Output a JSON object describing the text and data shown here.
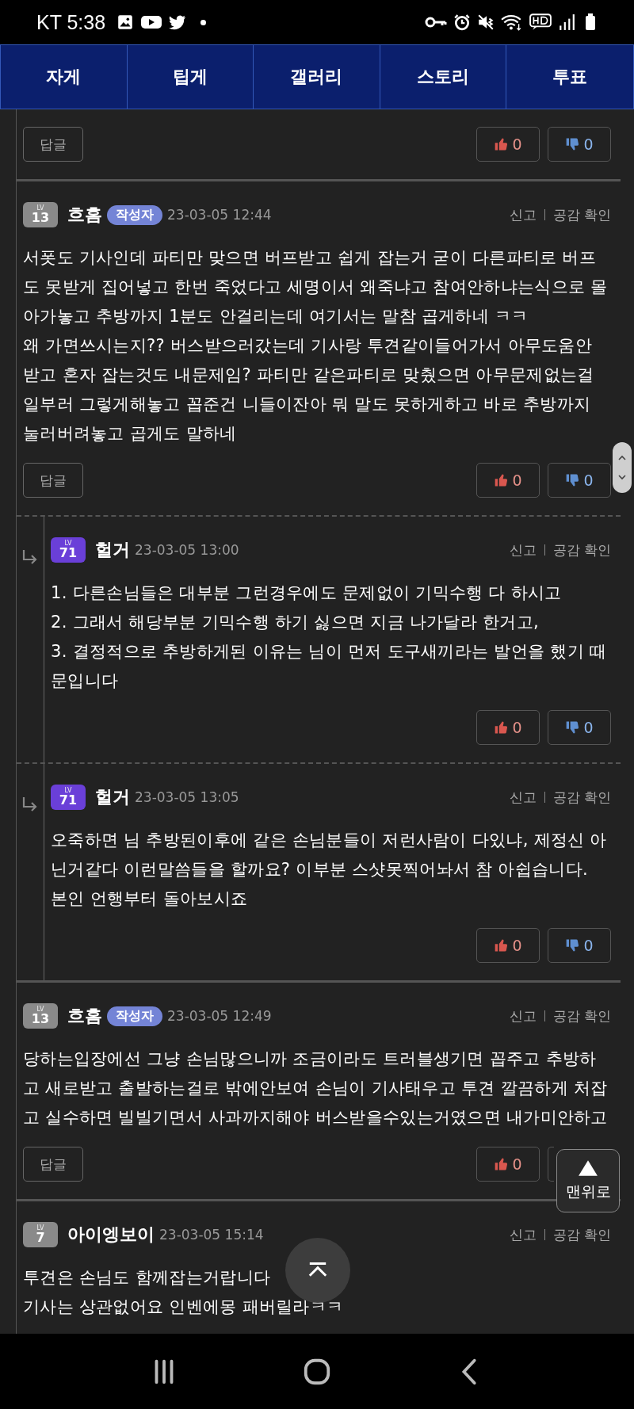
{
  "status_bar": {
    "carrier": "KT",
    "time": "5:38"
  },
  "nav_tabs": [
    {
      "label": "자게"
    },
    {
      "label": "팁게"
    },
    {
      "label": "갤러리"
    },
    {
      "label": "스토리"
    },
    {
      "label": "투표"
    }
  ],
  "top_fragment": {
    "reply_label": "답글",
    "likes": "0",
    "dislikes": "0"
  },
  "comments": [
    {
      "kind": "comment",
      "badge": {
        "color": "#8a8a8a",
        "label": "LV",
        "number": "13"
      },
      "author": "흐흠",
      "author_tag": "작성자",
      "date": "23-03-05 12:44",
      "actions": [
        "신고",
        "공감 확인"
      ],
      "body": "서폿도 기사인데 파티만 맞으면 버프받고 쉽게 잡는거 굳이 다른파티로 버프도 못받게 집어넣고 한번 죽었다고 세명이서 왜죽냐고 참여안하냐는식으로 몰아가놓고 추방까지 1분도 안걸리는데 여기서는 말참 곱게하네 ㅋㅋ\n왜 가면쓰시는지?? 버스받으러갔는데 기사랑 투견같이들어가서 아무도움안받고 혼자 잡는것도 내문제임? 파티만 같은파티로 맞췄으면 아무문제없는걸 일부러 그렇게해놓고 꼽준건 니들이잔아 뭐 말도 못하게하고 바로 추방까지 눌러버려놓고 곱게도 말하네",
      "reply_label": "답글",
      "likes": "0",
      "dislikes": "0"
    },
    {
      "kind": "reply",
      "badge": {
        "color": "#6a3fd8",
        "label": "LV",
        "number": "71"
      },
      "author": "헐거",
      "date": "23-03-05 13:00",
      "actions": [
        "신고",
        "공감 확인"
      ],
      "body": "1. 다른손님들은 대부분 그런경우에도 문제없이 기믹수행 다 하시고\n2. 그래서 해당부분 기믹수행 하기 싫으면 지금 나가달라 한거고,\n3. 결정적으로 추방하게된 이유는 님이 먼저 도구새끼라는 발언을 했기 때문입니다",
      "likes": "0",
      "dislikes": "0"
    },
    {
      "kind": "reply",
      "badge": {
        "color": "#6a3fd8",
        "label": "LV",
        "number": "71"
      },
      "author": "헐거",
      "date": "23-03-05 13:05",
      "actions": [
        "신고",
        "공감 확인"
      ],
      "body": "오죽하면 님 추방된이후에 같은 손님분들이 저런사람이 다있냐, 제정신 아닌거같다 이런말씀들을 할까요? 이부분 스샷못찍어놔서 참 아쉽습니다. 본인 언행부터 돌아보시죠",
      "likes": "0",
      "dislikes": "0"
    },
    {
      "kind": "comment",
      "badge": {
        "color": "#8a8a8a",
        "label": "LV",
        "number": "13"
      },
      "author": "흐흠",
      "author_tag": "작성자",
      "date": "23-03-05 12:49",
      "actions": [
        "신고",
        "공감 확인"
      ],
      "body": "당하는입장에선 그냥 손님많으니까 조금이라도 트러블생기면 꼽주고 추방하고 새로받고 출발하는걸로 밖에안보여 손님이 기사태우고 투견 깔끔하게 처잡고 실수하면 빌빌기면서 사과까지해야 버스받을수있는거였으면 내가미안하고",
      "reply_label": "답글",
      "likes": "0"
    },
    {
      "kind": "comment",
      "badge": {
        "color": "#8a8a8a",
        "label": "LV",
        "number": "7"
      },
      "author": "아이엥보이",
      "date": "23-03-05 15:14",
      "actions": [
        "신고",
        "공감 확인"
      ],
      "body": "투견은 손님도 함께잡는거랍니다\n기사는 상관없어요 인벤에몽 패버릴라ㅋㅋ"
    }
  ],
  "back_to_top": {
    "label": "맨위로"
  }
}
